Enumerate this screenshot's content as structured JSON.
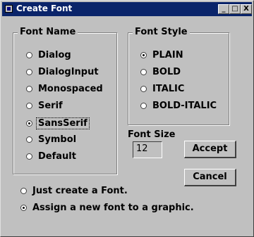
{
  "window": {
    "title": "Create Font",
    "minimize": "_",
    "maximize": "□",
    "close": "X"
  },
  "font_name": {
    "legend": "Font Name",
    "options": [
      "Dialog",
      "DialogInput",
      "Monospaced",
      "Serif",
      "SansSerif",
      "Symbol",
      "Default"
    ],
    "selected": "SansSerif"
  },
  "font_style": {
    "legend": "Font Style",
    "options": [
      "PLAIN",
      "BOLD",
      "ITALIC",
      "BOLD-ITALIC"
    ],
    "selected": "PLAIN"
  },
  "font_size": {
    "label": "Font Size",
    "value": "12"
  },
  "buttons": {
    "accept": "Accept",
    "cancel": "Cancel"
  },
  "actions": {
    "options": [
      "Just create a Font.",
      "Assign a new font to a graphic."
    ],
    "selected": "Assign a new font to a graphic."
  }
}
